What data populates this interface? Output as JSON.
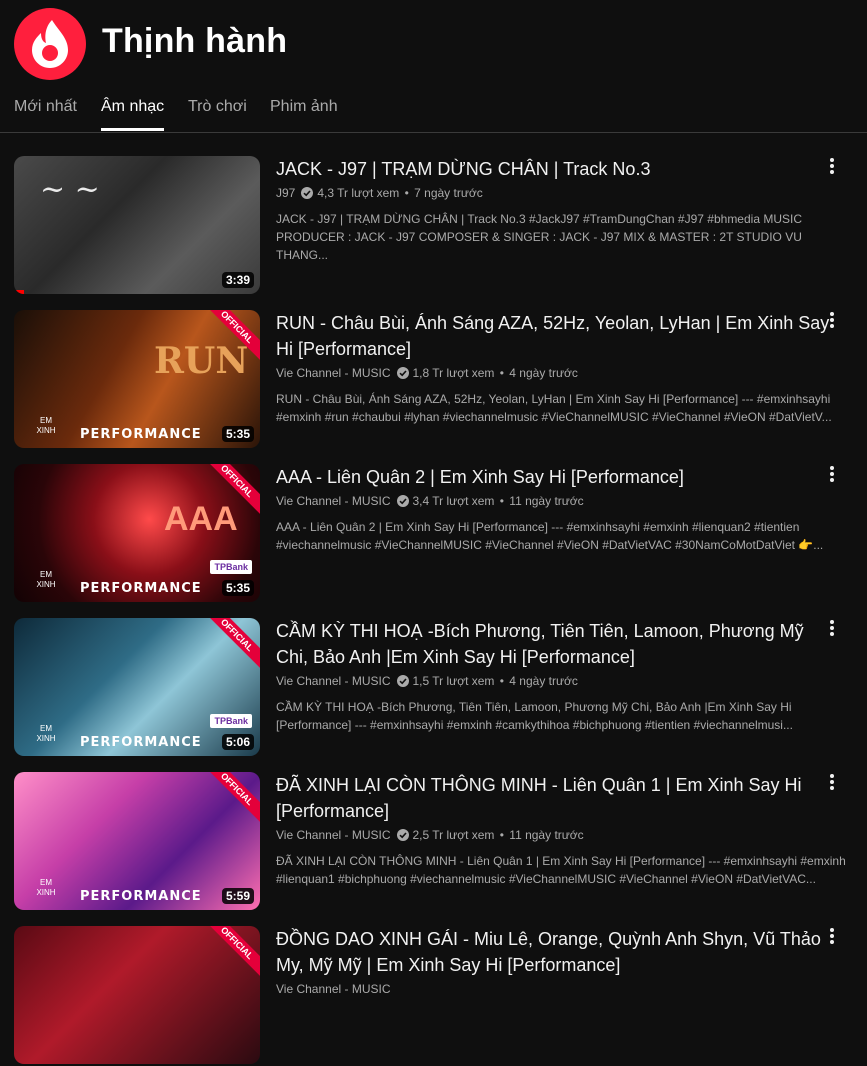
{
  "header": {
    "title": "Thịnh hành"
  },
  "tabs": [
    {
      "label": "Mới nhất",
      "active": false
    },
    {
      "label": "Âm nhạc",
      "active": true
    },
    {
      "label": "Trò chơi",
      "active": false
    },
    {
      "label": "Phim ảnh",
      "active": false
    }
  ],
  "videos": [
    {
      "title": "JACK - J97 | TRẠM DỪNG CHÂN | Track No.3",
      "channel": "J97",
      "views": "4,3 Tr lượt xem",
      "age": "7 ngày trước",
      "description": "JACK - J97 | TRẠM DỪNG CHÂN | Track No.3 #JackJ97 #TramDungChan #J97 #bhmedia MUSIC PRODUCER : JACK - J97 COMPOSER & SINGER : JACK - J97 MIX & MASTER : 2T STUDIO VU THANG...",
      "duration": "3:39",
      "watch_progress_percent": 4
    },
    {
      "title": "RUN - Châu Bùi, Ánh Sáng AZA, 52Hz, Yeolan, LyHan | Em Xinh Say Hi [Performance]",
      "channel": "Vie Channel - MUSIC",
      "views": "1,8 Tr lượt xem",
      "age": "4 ngày trước",
      "description": "RUN - Châu Bùi, Ánh Sáng AZA, 52Hz, Yeolan, LyHan | Em Xinh Say Hi [Performance] --- #emxinhsayhi #emxinh #run #chaubui #lyhan #viechannelmusic #VieChannelMUSIC #VieChannel #VieON #DatVietV...",
      "duration": "5:35",
      "badge": "OFFICIAL",
      "overlay": "PERFORMANCE",
      "thumb_text": "RUN"
    },
    {
      "title": "AAA - Liên Quân 2 | Em Xinh Say Hi [Performance]",
      "channel": "Vie Channel - MUSIC",
      "views": "3,4 Tr lượt xem",
      "age": "11 ngày trước",
      "description": "AAA - Liên Quân 2 | Em Xinh Say Hi [Performance] --- #emxinhsayhi #emxinh #lienquan2 #tientien #viechannelmusic #VieChannelMUSIC #VieChannel #VieON #DatVietVAC #30NamCoMotDatViet 👉...",
      "duration": "5:35",
      "badge": "OFFICIAL",
      "overlay": "PERFORMANCE",
      "sponsor": "TPBank",
      "thumb_text": "AAA"
    },
    {
      "title": "CẦM KỲ THI HOẠ -Bích Phương, Tiên Tiên, Lamoon, Phương Mỹ Chi, Bảo Anh |Em Xinh Say Hi [Performance]",
      "channel": "Vie Channel - MUSIC",
      "views": "1,5 Tr lượt xem",
      "age": "4 ngày trước",
      "description": "CẦM KỲ THI HOẠ -Bích Phương, Tiên Tiên, Lamoon, Phương Mỹ Chi, Bảo Anh |Em Xinh Say Hi [Performance] --- #emxinhsayhi #emxinh #camkythihoa #bichphuong #tientien #viechannelmusi...",
      "duration": "5:06",
      "badge": "OFFICIAL",
      "overlay": "PERFORMANCE",
      "sponsor": "TPBank"
    },
    {
      "title": "ĐÃ XINH LẠI CÒN THÔNG MINH - Liên Quân 1 | Em Xinh Say Hi [Performance]",
      "channel": "Vie Channel - MUSIC",
      "views": "2,5 Tr lượt xem",
      "age": "11 ngày trước",
      "description": "ĐÃ XINH LẠI CÒN THÔNG MINH - Liên Quân 1 | Em Xinh Say Hi [Performance] --- #emxinhsayhi #emxinh #lienquan1 #bichphuong #viechannelmusic #VieChannelMUSIC #VieChannel #VieON #DatVietVAC...",
      "duration": "5:59",
      "badge": "OFFICIAL",
      "overlay": "PERFORMANCE"
    },
    {
      "title": "ĐỒNG DAO XINH GÁI - Miu Lê, Orange, Quỳnh Anh Shyn, Vũ Thảo My, Mỹ Mỹ | Em Xinh Say Hi [Performance]",
      "channel": "Vie Channel - MUSIC",
      "badge": "OFFICIAL"
    }
  ]
}
